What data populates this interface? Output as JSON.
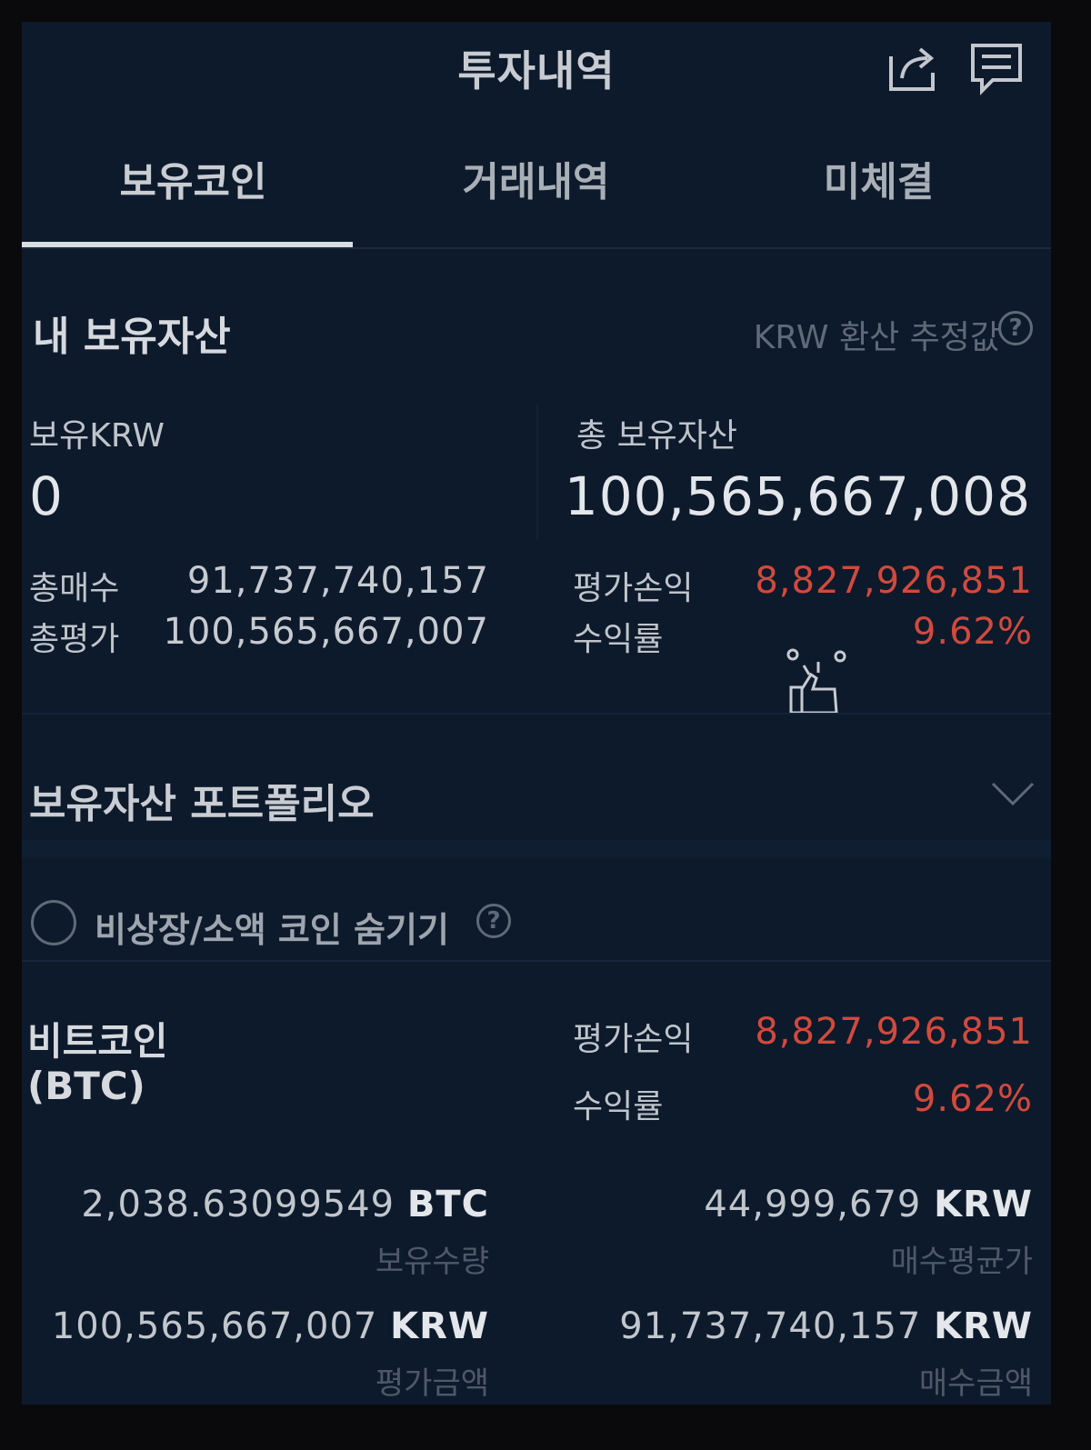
{
  "header": {
    "title": "투자내역",
    "share_icon": "share-icon",
    "chat_icon": "chat-icon"
  },
  "tabs": [
    {
      "label": "보유코인",
      "active": true
    },
    {
      "label": "거래내역",
      "active": false
    },
    {
      "label": "미체결",
      "active": false
    }
  ],
  "assets": {
    "title": "내 보유자산",
    "note": "KRW 환산 추정값",
    "krw_label": "보유KRW",
    "krw_value": "0",
    "total_label": "총 보유자산",
    "total_value": "100,565,667,008",
    "buy_total_label": "총매수",
    "buy_total_value": "91,737,740,157",
    "eval_total_label": "총평가",
    "eval_total_value": "100,565,667,007",
    "pnl_label": "평가손익",
    "pnl_value": "8,827,926,851",
    "return_label": "수익률",
    "return_value": "9.62%"
  },
  "portfolio": {
    "label": "보유자산 포트폴리오"
  },
  "filter": {
    "hide_label": "비상장/소액 코인 숨기기"
  },
  "coin": {
    "name": "비트코인",
    "ticker": "(BTC)",
    "pnl_label": "평가손익",
    "pnl_value": "8,827,926,851",
    "return_label": "수익률",
    "return_value": "9.62%",
    "qty_value": "2,038.63099549",
    "qty_unit": "BTC",
    "qty_label": "보유수량",
    "avg_value": "44,999,679",
    "avg_unit": "KRW",
    "avg_label": "매수평균가",
    "eval_value": "100,565,667,007",
    "eval_unit": "KRW",
    "eval_label": "평가금액",
    "buy_value": "91,737,740,157",
    "buy_unit": "KRW",
    "buy_label": "매수금액"
  },
  "colors": {
    "background": "#0d1a2b",
    "positive": "#d14a3d",
    "text": "#d2d6dc"
  }
}
